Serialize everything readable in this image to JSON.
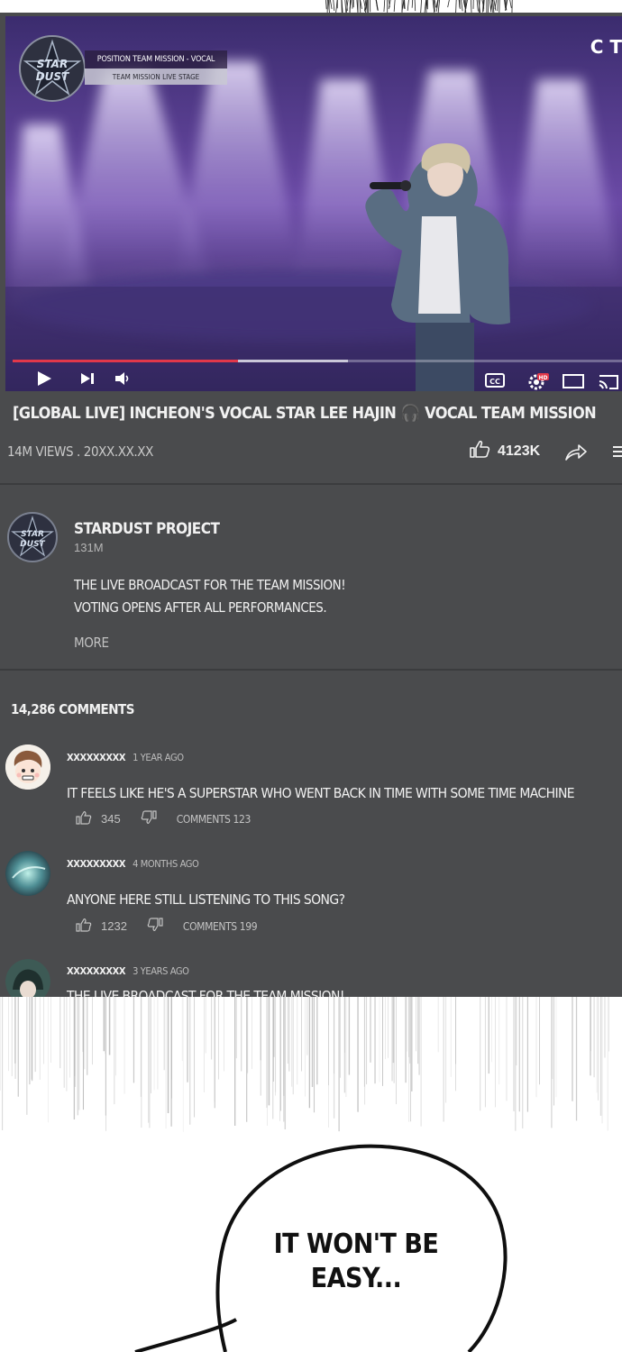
{
  "video": {
    "overlay_title": "POSITION TEAM MISSION - VOCAL",
    "overlay_subtitle": "TEAM MISSION LIVE STAGE",
    "channel_mark": "C T",
    "progress_played": 0.37,
    "progress_buffered": 0.55,
    "title": "[GLOBAL LIVE] INCHEON'S VOCAL STAR LEE HAJIN 🎧 VOCAL TEAM MISSION",
    "meta": "14M VIEWS . 20XX.XX.XX",
    "likes": "4123K",
    "controls": [
      "play-icon",
      "skip-next-icon",
      "volume-icon",
      "cc-icon",
      "hd-settings-icon",
      "miniplayer-icon",
      "cast-icon"
    ]
  },
  "channel": {
    "name": "STARDUST PROJECT",
    "subscribers": "131M",
    "description_lines": [
      "THE LIVE BROADCAST FOR THE TEAM MISSION!",
      "VOTING OPENS AFTER ALL PERFORMANCES."
    ],
    "more_label": "MORE"
  },
  "comments_header": "14,286 COMMENTS",
  "comments": [
    {
      "user": "XXXXXXXXX",
      "time": "1 YEAR AGO",
      "text": "IT FEELS LIKE HE'S A SUPERSTAR WHO WENT BACK IN TIME WITH SOME TIME MACHINE",
      "likes": "345",
      "replies": "COMMENTS 123"
    },
    {
      "user": "XXXXXXXXX",
      "time": "4 MONTHS AGO",
      "text": "ANYONE HERE STILL LISTENING TO THIS SONG?",
      "likes": "1232",
      "replies": "COMMENTS 199"
    },
    {
      "user": "XXXXXXXXX",
      "time": "3 YEARS AGO",
      "text": "THE LIVE BROADCAST FOR THE TEAM MISSION!"
    }
  ],
  "speech_bubble": {
    "line1": "IT WON'T BE",
    "line2": "EASY..."
  }
}
